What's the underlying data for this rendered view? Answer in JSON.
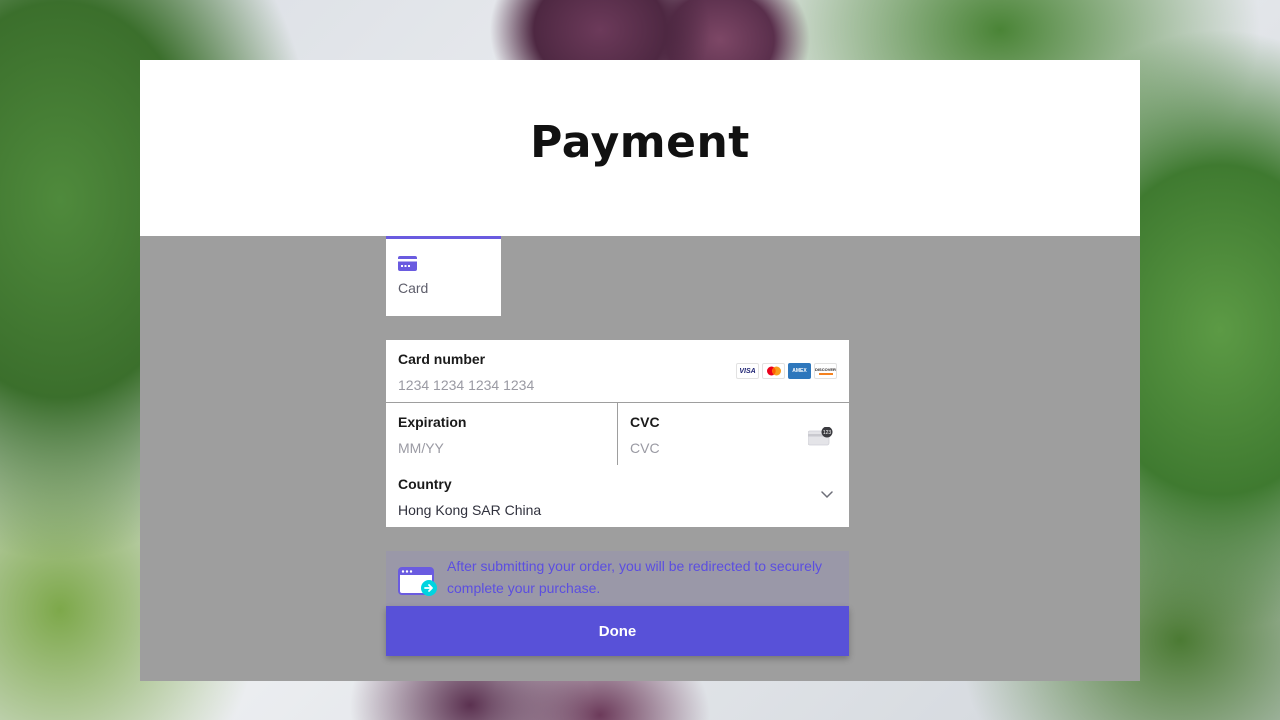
{
  "page": {
    "title": "Payment"
  },
  "payment_methods": [
    {
      "label": "Card",
      "icon": "credit-card-icon",
      "selected": true
    }
  ],
  "card_number": {
    "label": "Card number",
    "placeholder": "1234 1234 1234 1234",
    "value": "",
    "brands": [
      "VISA",
      "Mastercard",
      "AMEX",
      "DISCOVER"
    ]
  },
  "expiration": {
    "label": "Expiration",
    "placeholder": "MM/YY",
    "value": ""
  },
  "cvc": {
    "label": "CVC",
    "placeholder": "CVC",
    "value": "",
    "icon": "cvc-card-icon",
    "icon_text": "123"
  },
  "country": {
    "label": "Country",
    "value": "Hong Kong SAR China",
    "icon": "chevron-down-icon"
  },
  "notice": {
    "text": "After submitting your order, you will be redirected to securely complete your purchase.",
    "icon": "redirect-browser-icon"
  },
  "submit": {
    "label": "Done"
  },
  "colors": {
    "accent": "#6a5be0",
    "button": "#5851d8",
    "overlay": "#9e9e9e",
    "notice_text": "#5b4ee0"
  }
}
